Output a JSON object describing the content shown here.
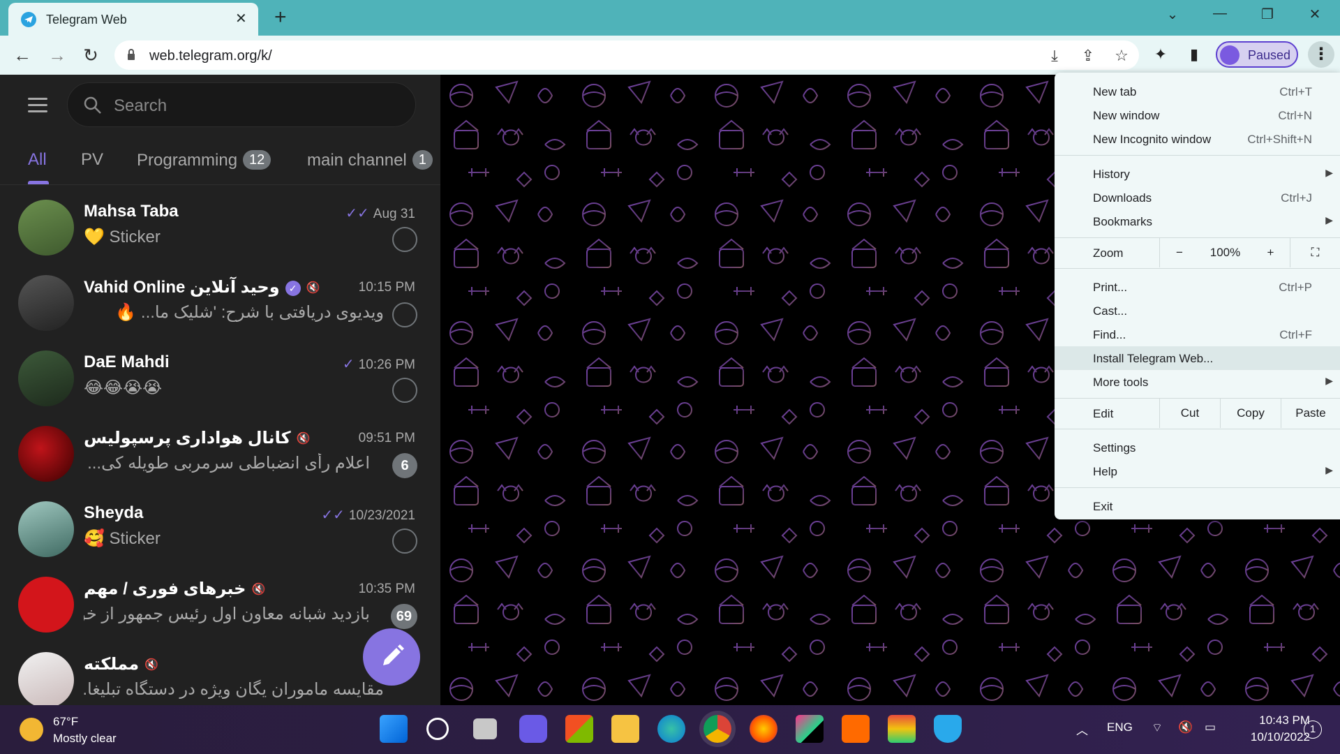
{
  "browser": {
    "tab_title": "Telegram Web",
    "url": "web.telegram.org/k/",
    "profile_label": "Paused",
    "accent": "#4fb3b9"
  },
  "telegram": {
    "search_placeholder": "Search",
    "folders": [
      {
        "label": "All",
        "badge": null,
        "active": true
      },
      {
        "label": "PV",
        "badge": null,
        "active": false
      },
      {
        "label": "Programming",
        "badge": "12",
        "active": false
      },
      {
        "label": "main channel",
        "badge": "1",
        "active": false
      }
    ],
    "chats": [
      {
        "name": "Mahsa Taba",
        "time": "Aug 31",
        "status": "read",
        "message": "💛 Sticker",
        "badge": null,
        "pinned": true,
        "muted": false,
        "verified": false,
        "rtl": false
      },
      {
        "name": "Vahid Online وحید آنلاین",
        "time": "10:15 PM",
        "status": null,
        "message": "ویدیوی دریافتی با شرح: 'شلیک ما... 🔥",
        "badge": null,
        "pinned": true,
        "muted": true,
        "verified": true,
        "rtl": true
      },
      {
        "name": "DaE Mahdi",
        "time": "10:26 PM",
        "status": "sent",
        "message": "😂😂😭😭",
        "badge": null,
        "pinned": true,
        "muted": false,
        "verified": false,
        "rtl": false
      },
      {
        "name": "کانال هواداری پرسپولیس",
        "time": "09:51 PM",
        "status": null,
        "message": "اعلام رأی انضباطی سرمربی طویله کی...",
        "badge": "6",
        "pinned": false,
        "muted": true,
        "verified": false,
        "rtl": true
      },
      {
        "name": "Sheyda",
        "time": "10/23/2021",
        "status": "read",
        "message": "🥰 Sticker",
        "badge": null,
        "pinned": true,
        "muted": false,
        "verified": false,
        "rtl": false
      },
      {
        "name": "خبرهای فوری / مهم",
        "time": "10:35 PM",
        "status": null,
        "message": "بازدید شبانه معاون اول رئیس جمهور از خو...",
        "badge": "69",
        "pinned": false,
        "muted": true,
        "verified": false,
        "rtl": true
      },
      {
        "name": "مملکته",
        "time": "",
        "status": null,
        "message": "مقایسه ماموران یگان ویژه در دستگاه تبلیغا...",
        "badge": null,
        "pinned": false,
        "muted": true,
        "verified": false,
        "rtl": true
      }
    ],
    "accent": "#8774e1"
  },
  "menu": {
    "items": [
      {
        "label": "New tab",
        "shortcut": "Ctrl+T"
      },
      {
        "label": "New window",
        "shortcut": "Ctrl+N"
      },
      {
        "label": "New Incognito window",
        "shortcut": "Ctrl+Shift+N"
      },
      {
        "label": "History",
        "shortcut": ""
      },
      {
        "label": "Downloads",
        "shortcut": "Ctrl+J"
      },
      {
        "label": "Bookmarks",
        "shortcut": ""
      },
      {
        "label": "Print...",
        "shortcut": "Ctrl+P"
      },
      {
        "label": "Cast...",
        "shortcut": ""
      },
      {
        "label": "Find...",
        "shortcut": "Ctrl+F"
      },
      {
        "label": "Install Telegram Web...",
        "shortcut": ""
      },
      {
        "label": "More tools",
        "shortcut": ""
      },
      {
        "label": "Settings",
        "shortcut": ""
      },
      {
        "label": "Help",
        "shortcut": ""
      },
      {
        "label": "Exit",
        "shortcut": ""
      }
    ],
    "zoom": {
      "label": "Zoom",
      "minus": "−",
      "value": "100%",
      "plus": "+"
    },
    "edit": {
      "label": "Edit",
      "cut": "Cut",
      "copy": "Copy",
      "paste": "Paste"
    }
  },
  "taskbar": {
    "weather_temp": "67°F",
    "weather_desc": "Mostly clear",
    "lang": "ENG",
    "time": "10:43 PM",
    "date": "10/10/2022",
    "notifications": "1"
  }
}
